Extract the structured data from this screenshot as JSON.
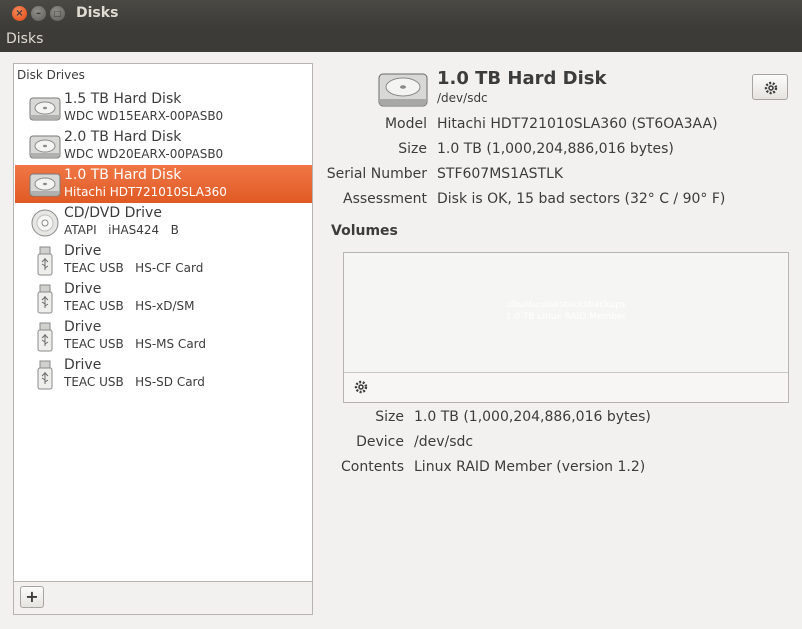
{
  "window": {
    "title": "Disks",
    "close_glyph": "×",
    "minimize_glyph": "–",
    "maximize_glyph": "□"
  },
  "menubar": {
    "disks": "Disks"
  },
  "sidebar": {
    "header": "Disk Drives",
    "drives": [
      {
        "name": "1.5 TB Hard Disk",
        "model": "WDC WD15EARX-00PASB0",
        "icon": "harddisk-icon"
      },
      {
        "name": "2.0 TB Hard Disk",
        "model": "WDC WD20EARX-00PASB0",
        "icon": "harddisk-icon"
      },
      {
        "name": "1.0 TB Hard Disk",
        "model": "Hitachi HDT721010SLA360",
        "icon": "harddisk-icon",
        "selected": true
      },
      {
        "name": "CD/DVD Drive",
        "model": "ATAPI   iHAS424   B",
        "icon": "optical-disc-icon"
      },
      {
        "name": "Drive",
        "model": "TEAC USB   HS-CF Card",
        "icon": "usb-drive-icon"
      },
      {
        "name": "Drive",
        "model": "TEAC USB   HS-xD/SM",
        "icon": "usb-drive-icon"
      },
      {
        "name": "Drive",
        "model": "TEAC USB   HS-MS Card",
        "icon": "usb-drive-icon"
      },
      {
        "name": "Drive",
        "model": "TEAC USB   HS-SD Card",
        "icon": "usb-drive-icon"
      }
    ],
    "add_label": "+"
  },
  "detail": {
    "title": "1.0 TB Hard Disk",
    "device": "/dev/sdc",
    "properties": {
      "model_label": "Model",
      "model_value": "Hitachi HDT721010SLA360 (ST6OA3AA)",
      "size_label": "Size",
      "size_value": "1.0 TB (1,000,204,886,016 bytes)",
      "serial_label": "Serial Number",
      "serial_value": "STF607MS1ASTLK",
      "assessment_label": "Assessment",
      "assessment_value": "Disk is OK, 15 bad sectors (32° C / 90° F)"
    },
    "volumes_heading": "Volumes",
    "volume_map": {
      "line1": "ubuntu:diskstacksbackups",
      "line2": "1.0 TB Linux RAID Member"
    },
    "volume_properties": {
      "size_label": "Size",
      "size_value": "1.0 TB (1,000,204,886,016 bytes)",
      "device_label": "Device",
      "device_value": "/dev/sdc",
      "contents_label": "Contents",
      "contents_value": "Linux RAID Member (version 1.2)"
    }
  },
  "colors": {
    "selection": "#e9642e",
    "titlebar": "#3c3b37",
    "background": "#f2f1f0"
  }
}
